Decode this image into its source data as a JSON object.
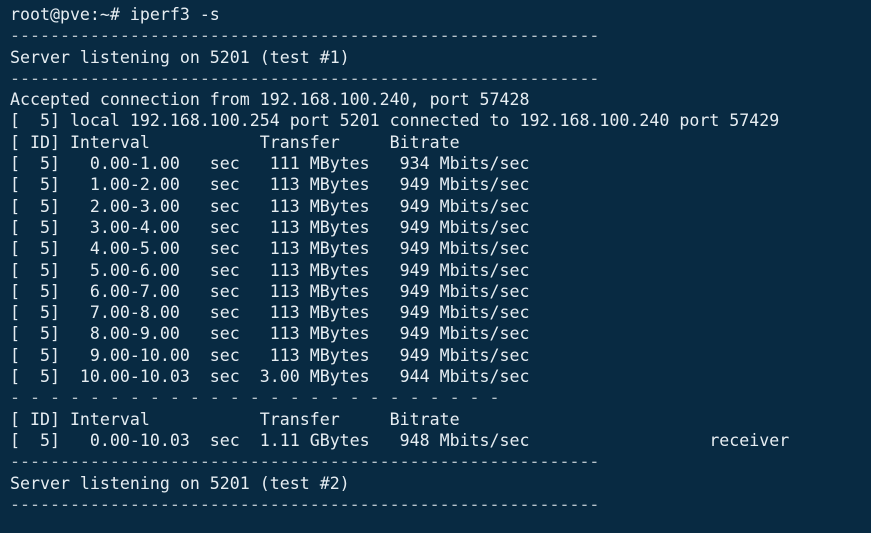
{
  "terminal": {
    "background": "#082a42",
    "foreground": "#e6edf2",
    "lines": [
      "root@pve:~# iperf3 -s",
      "-----------------------------------------------------------",
      "Server listening on 5201 (test #1)",
      "-----------------------------------------------------------",
      "Accepted connection from 192.168.100.240, port 57428",
      "[  5] local 192.168.100.254 port 5201 connected to 192.168.100.240 port 57429",
      "[ ID] Interval           Transfer     Bitrate",
      "[  5]   0.00-1.00   sec   111 MBytes   934 Mbits/sec",
      "[  5]   1.00-2.00   sec   113 MBytes   949 Mbits/sec",
      "[  5]   2.00-3.00   sec   113 MBytes   949 Mbits/sec",
      "[  5]   3.00-4.00   sec   113 MBytes   949 Mbits/sec",
      "[  5]   4.00-5.00   sec   113 MBytes   949 Mbits/sec",
      "[  5]   5.00-6.00   sec   113 MBytes   949 Mbits/sec",
      "[  5]   6.00-7.00   sec   113 MBytes   949 Mbits/sec",
      "[  5]   7.00-8.00   sec   113 MBytes   949 Mbits/sec",
      "[  5]   8.00-9.00   sec   113 MBytes   949 Mbits/sec",
      "[  5]   9.00-10.00  sec   113 MBytes   949 Mbits/sec",
      "[  5]  10.00-10.03  sec  3.00 MBytes   944 Mbits/sec",
      "- - - - - - - - - - - - - - - - - - - - - - - - -",
      "[ ID] Interval           Transfer     Bitrate",
      "[  5]   0.00-10.03  sec  1.11 GBytes   948 Mbits/sec                  receiver",
      "-----------------------------------------------------------",
      "Server listening on 5201 (test #2)",
      "-----------------------------------------------------------"
    ]
  }
}
